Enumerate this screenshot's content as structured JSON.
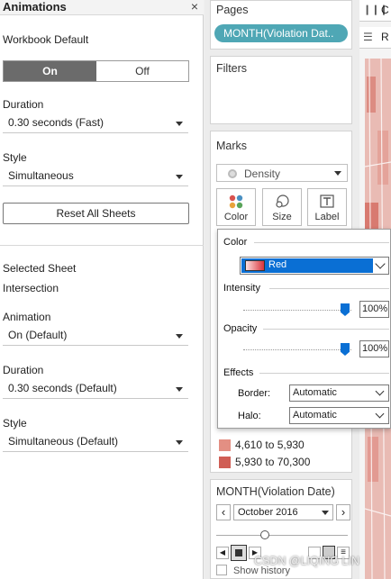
{
  "animations": {
    "title": "Animations",
    "close_glyph": "×",
    "workbook_default_label": "Workbook Default",
    "toggle": {
      "on": "On",
      "off": "Off"
    },
    "duration_label": "Duration",
    "duration_value": "0.30 seconds (Fast)",
    "style_label": "Style",
    "style_value": "Simultaneous",
    "reset_button": "Reset All Sheets",
    "selected_sheet_label": "Selected Sheet",
    "sheet_name": "Intersection",
    "animation_label": "Animation",
    "animation_value": "On (Default)",
    "sheet_duration_label": "Duration",
    "sheet_duration_value": "0.30 seconds (Default)",
    "sheet_style_label": "Style",
    "sheet_style_value": "Simultaneous (Default)"
  },
  "shelves": {
    "pages_title": "Pages",
    "pages_pill": "MONTH(Violation Dat..",
    "filters_title": "Filters",
    "marks_title": "Marks",
    "mark_type": "Density",
    "mark_buttons": [
      "Color",
      "Size",
      "Label"
    ],
    "legend_items": [
      {
        "label": "4,610 to 5,930",
        "color": "#e38f83"
      },
      {
        "label": "5,930 to 70,300",
        "color": "#d05e55"
      }
    ],
    "page_card_title": "MONTH(Violation Date)",
    "page_value": "October 2016",
    "show_history": "Show history"
  },
  "color_popup": {
    "color_label": "Color",
    "palette": "Red",
    "intensity_label": "Intensity",
    "intensity_value": "100%",
    "intensity_level": 1.0,
    "opacity_label": "Opacity",
    "opacity_value": "100%",
    "opacity_level": 1.0,
    "effects_label": "Effects",
    "border_label": "Border:",
    "border_value": "Automatic",
    "halo_label": "Halo:",
    "halo_value": "Automatic"
  },
  "right_tabs": {
    "tab1": "C",
    "tab2": "R"
  },
  "watermark": "CSDN @LIQING LIN",
  "colors": {
    "accent": "#0a6fd4",
    "pill": "#4fa7b5",
    "map": "#e7b7b2"
  }
}
